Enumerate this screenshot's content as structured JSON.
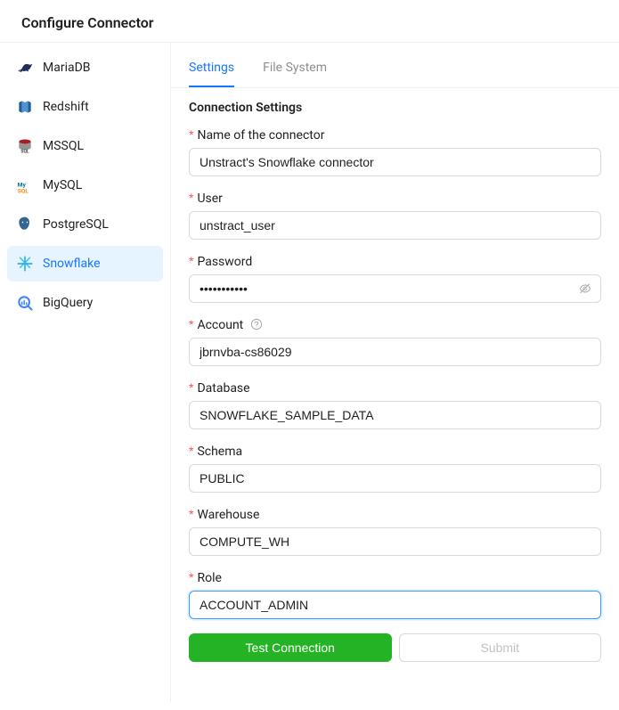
{
  "header": {
    "title": "Configure Connector"
  },
  "sidebar": {
    "items": [
      {
        "label": "MariaDB",
        "icon": "mariadb-icon"
      },
      {
        "label": "Redshift",
        "icon": "redshift-icon"
      },
      {
        "label": "MSSQL",
        "icon": "mssql-icon"
      },
      {
        "label": "MySQL",
        "icon": "mysql-icon"
      },
      {
        "label": "PostgreSQL",
        "icon": "postgresql-icon"
      },
      {
        "label": "Snowflake",
        "icon": "snowflake-icon"
      },
      {
        "label": "BigQuery",
        "icon": "bigquery-icon"
      }
    ],
    "active_index": 5
  },
  "tabs": {
    "items": [
      {
        "label": "Settings"
      },
      {
        "label": "File System"
      }
    ],
    "active_index": 0
  },
  "form": {
    "section_title": "Connection Settings",
    "fields": {
      "name": {
        "label": "Name of the connector",
        "value": "Unstract's Snowflake connector",
        "required": true
      },
      "user": {
        "label": "User",
        "value": "unstract_user",
        "required": true
      },
      "password": {
        "label": "Password",
        "value": "•••••••••••",
        "required": true
      },
      "account": {
        "label": "Account",
        "value": "jbrnvba-cs86029",
        "required": true,
        "help": true
      },
      "database": {
        "label": "Database",
        "value": "SNOWFLAKE_SAMPLE_DATA",
        "required": true
      },
      "schema": {
        "label": "Schema",
        "value": "PUBLIC",
        "required": true
      },
      "warehouse": {
        "label": "Warehouse",
        "value": "COMPUTE_WH",
        "required": true
      },
      "role": {
        "label": "Role",
        "value": "ACCOUNT_ADMIN",
        "required": true,
        "focused": true
      }
    },
    "buttons": {
      "test": "Test Connection",
      "submit": "Submit"
    }
  }
}
